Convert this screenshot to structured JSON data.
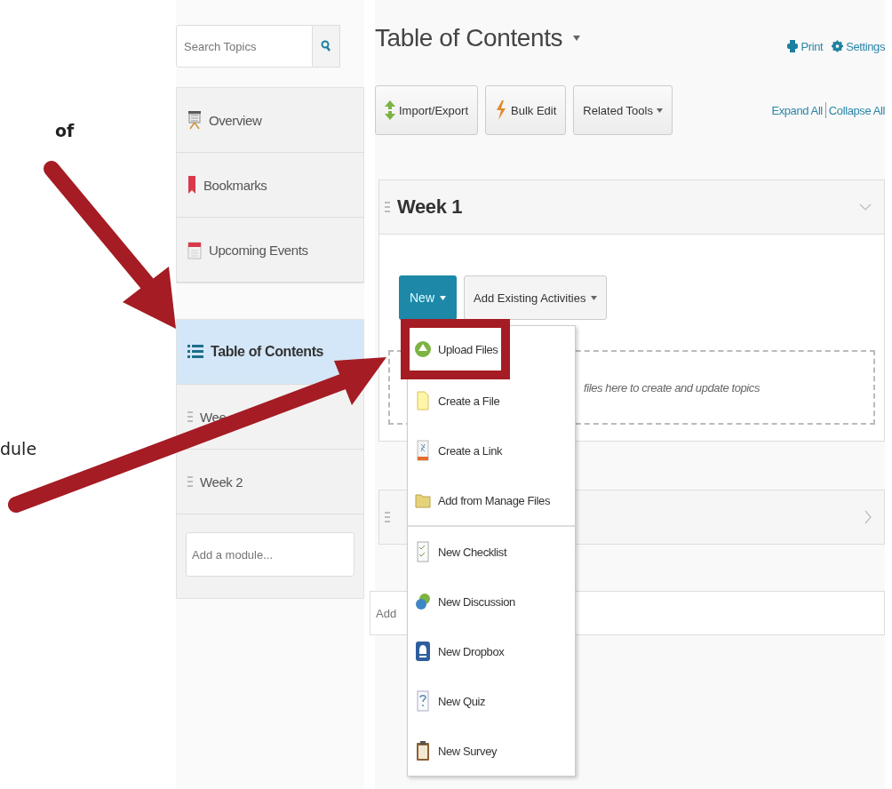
{
  "annotation_texts": [
    "of",
    "dule"
  ],
  "search": {
    "placeholder": "Search Topics"
  },
  "nav": [
    {
      "label": "Overview",
      "kind": "overview"
    },
    {
      "label": "Bookmarks",
      "kind": "bookmark"
    },
    {
      "label": "Upcoming Events",
      "kind": "calendar"
    }
  ],
  "modules": [
    {
      "label": "Table of Contents",
      "kind": "toc",
      "selected": true
    },
    {
      "label": "Wee",
      "kind": "module",
      "selected": false
    },
    {
      "label": "Week 2",
      "kind": "module",
      "selected": false
    }
  ],
  "add_module": {
    "placeholder": "Add a module..."
  },
  "page": {
    "title": "Table of Contents",
    "links": [
      {
        "label": "Print",
        "kind": "print"
      },
      {
        "label": "Settings",
        "kind": "settings"
      }
    ]
  },
  "toolbar": [
    {
      "label": "Import/Export",
      "kind": "import"
    },
    {
      "label": "Bulk Edit",
      "kind": "bulk"
    },
    {
      "label": "Related Tools",
      "kind": "dropdown"
    }
  ],
  "expand_links": [
    "Expand All",
    "Collapse All"
  ],
  "cards": [
    {
      "title": "Week 1",
      "expanded": true,
      "new_button": "New",
      "add_existing": "Add Existing Activities",
      "dropzone": "files here to create and update topics"
    },
    {
      "expanded": false
    }
  ],
  "add_field": {
    "placeholder": "Add"
  },
  "menu": {
    "groups": [
      [
        {
          "label": "Upload Files",
          "kind": "upload",
          "boxed": true
        },
        {
          "label": "Create a File",
          "kind": "file",
          "boxed": false
        },
        {
          "label": "Create a Link",
          "kind": "link",
          "boxed": false
        },
        {
          "label": "Add from Manage Files",
          "kind": "folder",
          "boxed": false
        }
      ],
      [
        {
          "label": "New Checklist",
          "kind": "checklist",
          "boxed": false
        },
        {
          "label": "New Discussion",
          "kind": "discussion",
          "boxed": false
        },
        {
          "label": "New Dropbox",
          "kind": "dropbox",
          "boxed": false
        },
        {
          "label": "New Quiz",
          "kind": "quiz",
          "boxed": false
        },
        {
          "label": "New Survey",
          "kind": "survey",
          "boxed": false
        }
      ]
    ]
  }
}
